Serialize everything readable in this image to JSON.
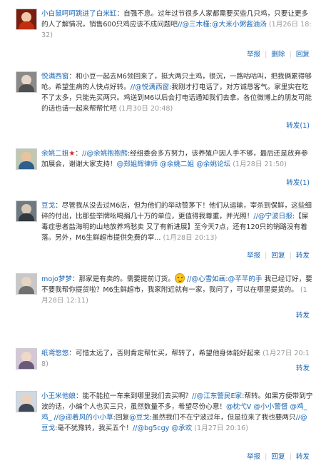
{
  "comments": [
    {
      "nick": "小白鼠呵呵跳进了白米缸",
      "sep": "：",
      "body": "自强不息。过年过节很多人家都需要买些几只鸡，只要让更多的人了解情况，销售600只鸡应该不成问题吧",
      "mention1": "//@三木槿",
      "colon1": ":",
      "mention2": "@大米小粥酱油汤",
      "time": "(1月26日 18:32)",
      "actions": [
        "举报",
        "删除",
        "回复"
      ]
    },
    {
      "nick": "悦满西窗",
      "sep": "：",
      "body": "和小豆一起去M6领回来了，挺大两只土鸡，很沉，一路咕咕叫，把我俩累得够呛。希望生病的人快点好转。",
      "mention1": "//@悦满西窗",
      "rest": ":我刚才打电话了，对方诚恳客气。家里实在吃不了太多，只能先买两只。鸡送到M6以后会打电话通知我们去拿。各位微博上的朋友可能的话也请一起来帮帮忙吧",
      "time": "(1月30日 20:48)",
      "actions": [
        "转发(1)"
      ]
    },
    {
      "nick": "余姚二姐",
      "badge": "★",
      "sep": "：",
      "mention1": "//@余姚抱抱熊",
      "body": ":经组委会多方努力，该养殖户因人手不够，最后还是放弃参加展会，谢谢大家支持！",
      "mention2": "@郑姐辉律师",
      "mention3": "@余姚二姐",
      "mention4": "@余姚论坛",
      "time": "(1月28日 21:50)",
      "actions": [
        "转发(1)"
      ]
    },
    {
      "nick": "豆戈",
      "sep": "：",
      "body": "尽管我从没去过M6店，但为他们的举动赞茅下！他们从运输，宰杀到保鲜，这些细碎的付出，比那些举牌吆喝捐几十万的单位，更值得我尊重，并光照！",
      "mention1": "//@宁波日报",
      "rest": ":【屎毒症患者盐海明的山地放养鸡愁卖 又了有新进展】至今天7点，还有120只的销路没有着落。另外，M6生鲜超市提供免费的宰...",
      "time": "(1月28日 20:13)",
      "actions": [
        "举报",
        "回复",
        "转发"
      ]
    },
    {
      "nick": "mojo梦梦",
      "sep": "：",
      "body": "那家是有卖的。需要提前订货。",
      "mention1": "//@心雪如画",
      "mention2": "@芊芊的手",
      "rest1": "我已经订好，要不要我帮你提货啦？M6生鲜超市，我家附近就有一家，我问了，可以在哪里提货的。",
      "colon1": ":",
      "time": "(1月28日 12:11)",
      "actions": [
        "转发"
      ]
    },
    {
      "nick": "纸鸢悠悠",
      "sep": "：",
      "body": "可惜太远了，否则肯定帮忙买，帮转了，希望他身体能好起来",
      "time": "(1月27日 20:18)",
      "actions": [
        "转发"
      ]
    },
    {
      "nick": "小王米他娘",
      "sep": "：",
      "body": "能不能拉一车来到哪里我们去买啊？",
      "mention1": "//@江东警民E家",
      "rest1": ":帮转。如果方便带到宁波的话，小编个人也买三只，虽然数量不多，希望尽份心意！",
      "mention2": "@枕弋V",
      "mention3": "@小小警督",
      "mention4": "@鸡_鸡_",
      "mention5": "//@迎着风的小小草",
      "rest2": ":回复",
      "mention6": "@豆戈",
      "rest3": ":虽然我们不在宁波过年，但是拉来了我也要两只",
      "mention7": "//@豆戈",
      "rest4": ":毫不犹豫转，我买五个！",
      "mention8": "//@bg5cgy",
      "mention9": "@承欢",
      "time": "(1月27日 20:16)",
      "actions": [
        "举报",
        "回复",
        "转发"
      ]
    }
  ]
}
